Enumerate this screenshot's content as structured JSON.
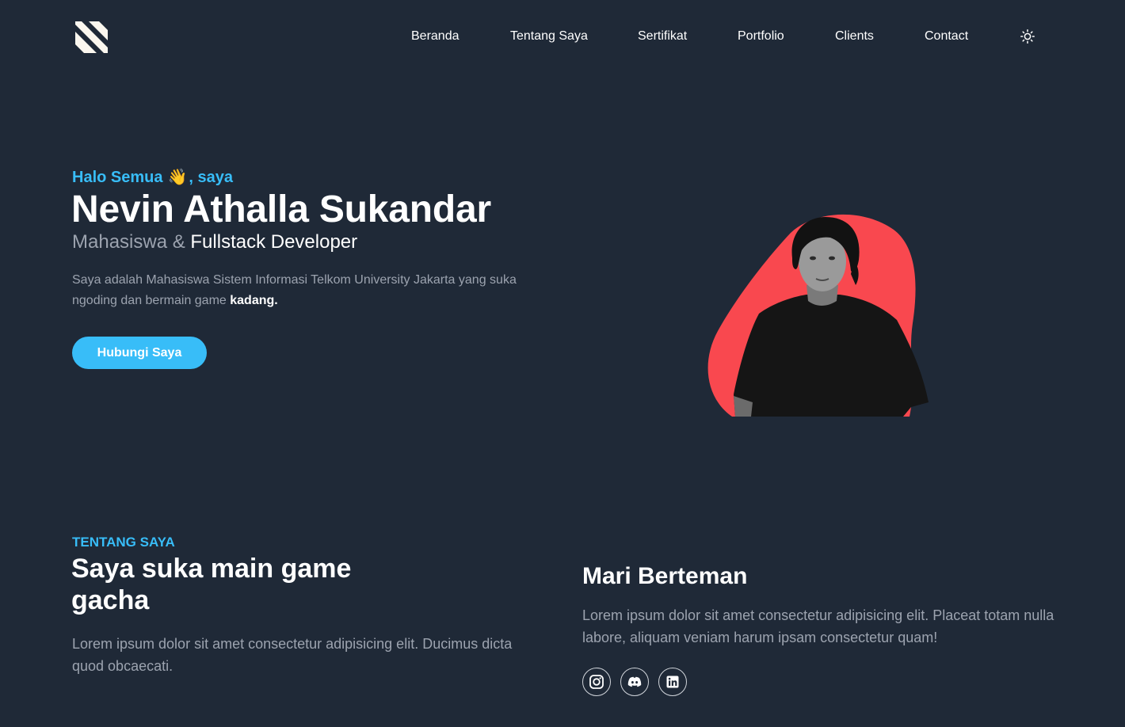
{
  "header": {
    "logo_icon": "n-logo-icon",
    "nav": [
      {
        "label": "Beranda"
      },
      {
        "label": "Tentang Saya"
      },
      {
        "label": "Sertifikat"
      },
      {
        "label": "Portfolio"
      },
      {
        "label": "Clients"
      },
      {
        "label": "Contact"
      }
    ],
    "theme_icon": "sun-icon"
  },
  "hero": {
    "greeting_prefix": "Halo Semua",
    "greeting_emoji": "👋",
    "greeting_suffix": ", saya",
    "name": "Nevin Athalla Sukandar",
    "role_primary": "Mahasiswa",
    "role_amp": " & ",
    "role_secondary": "Fullstack Developer",
    "description": "Saya adalah Mahasiswa Sistem Informasi Telkom University Jakarta yang suka ngoding dan bermain game ",
    "description_bold": "kadang.",
    "cta_label": "Hubungi Saya",
    "photo_icon": "profile-photo",
    "blob_color": "#f9484f"
  },
  "about": {
    "kicker": "TENTANG SAYA",
    "title": "Saya suka main game gacha",
    "description": "Lorem ipsum dolor sit amet consectetur adipisicing elit. Ducimus dicta quod obcaecati.",
    "friend_title": "Mari Berteman",
    "friend_description": "Lorem ipsum dolor sit amet consectetur adipisicing elit. Placeat totam nulla labore, aliquam veniam harum ipsam consectetur quam!",
    "socials": [
      {
        "icon": "instagram-icon"
      },
      {
        "icon": "discord-icon"
      },
      {
        "icon": "linkedin-icon"
      }
    ]
  },
  "colors": {
    "background": "#1f2937",
    "accent": "#38bdf8",
    "muted_text": "#9ca3af",
    "blob": "#f9484f"
  }
}
